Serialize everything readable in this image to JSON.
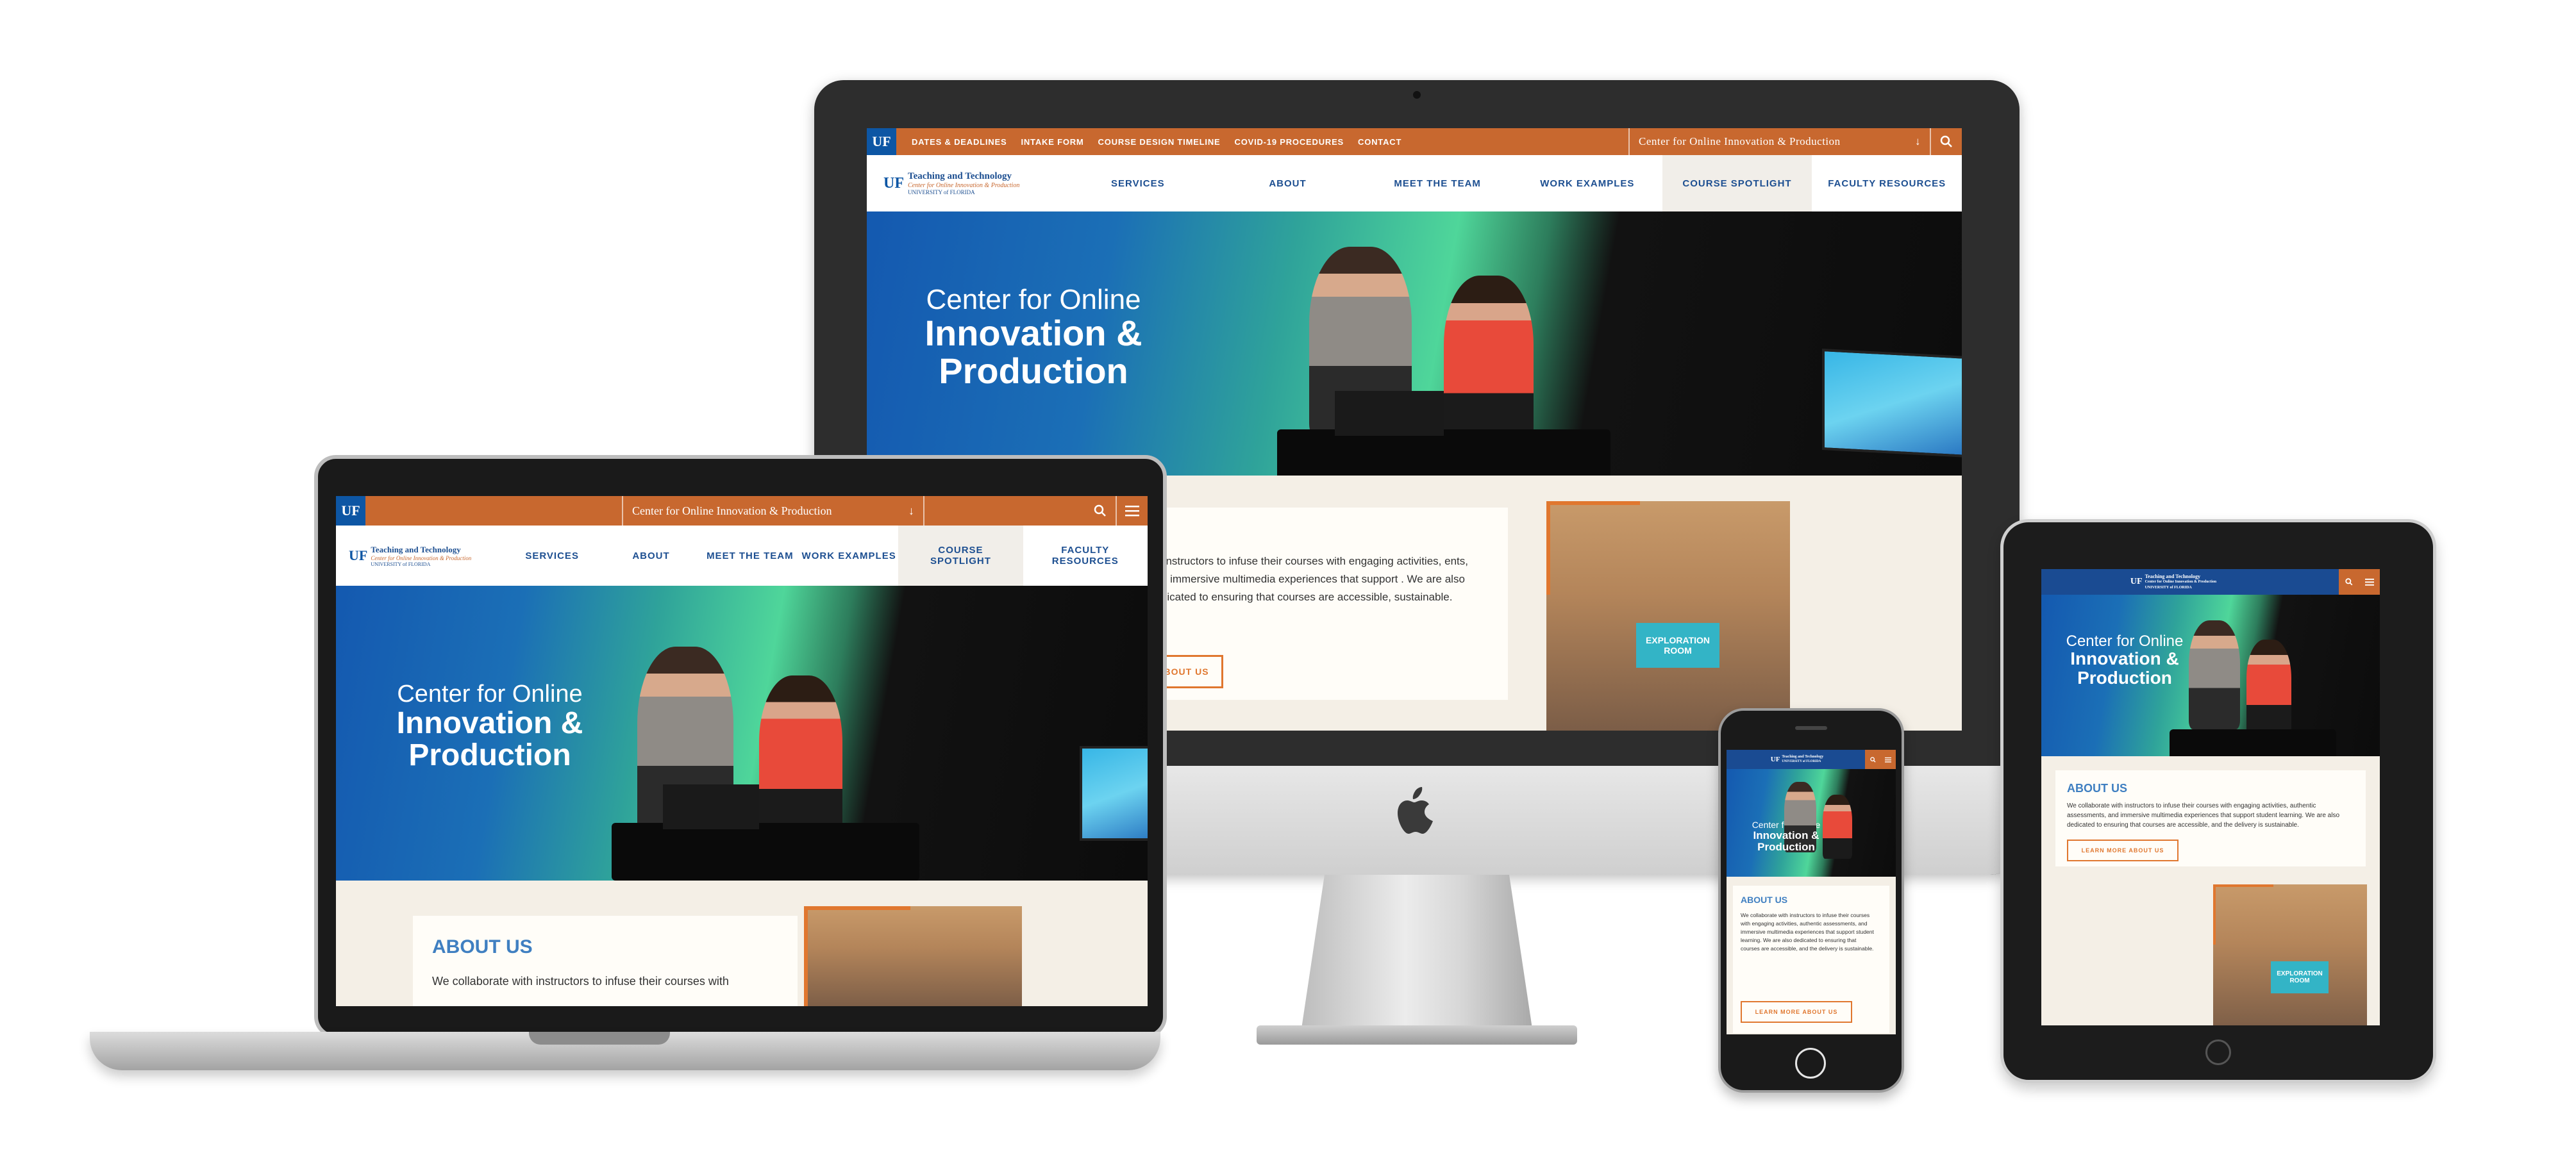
{
  "site": {
    "logo": "UF",
    "brand_title": "Teaching and Technology",
    "brand_subtitle": "Center for Online Innovation & Production",
    "brand_university": "UNIVERSITY of FLORIDA",
    "utility_links": [
      "DATES & DEADLINES",
      "INTAKE FORM",
      "COURSE DESIGN TIMELINE",
      "COVID-19 PROCEDURES",
      "CONTACT"
    ],
    "dropdown_label": "Center for Online Innovation & Production",
    "nav": [
      "SERVICES",
      "ABOUT",
      "MEET THE TEAM",
      "WORK EXAMPLES",
      "COURSE SPOTLIGHT",
      "FACULTY RESOURCES"
    ],
    "nav_laptop": [
      "SERVICES",
      "ABOUT",
      "MEET THE TEAM",
      "WORK EXAMPLES",
      "COURSE SPOTLIGHT",
      "FACULTY RESOURCES"
    ],
    "hero_line1": "Center for Online",
    "hero_line2": "Innovation &",
    "hero_line3": "Production",
    "about_heading": "ABOUT US",
    "about_text_desktop": "ch instructors to infuse their courses with engaging activities, ents, and immersive multimedia experiences that support . We are also dedicated to ensuring that courses are accessible, sustainable.",
    "about_text_laptop": "We collaborate with instructors to infuse their courses with",
    "about_text_tablet": "We collaborate with instructors to infuse their courses with engaging activities, authentic assessments, and immersive multimedia experiences that support student learning. We are also dedicated to ensuring that courses are accessible, and the delivery is sustainable.",
    "about_text_phone": "We collaborate with instructors to infuse their courses with engaging activities, authentic assessments, and immersive multimedia experiences that support student learning. We are also dedicated to ensuring that courses are accessible, and the delivery is sustainable.",
    "about_button_desktop": "ABOUT US",
    "about_button": "LEARN MORE ABOUT US",
    "about_heading_partial": "S",
    "photo_sign": "EXPLORATION ROOM"
  },
  "colors": {
    "orange": "#c8682f",
    "blue": "#0d56a4",
    "nav_blue": "#1d4f91",
    "accent_orange": "#f07a25",
    "about_blue": "#3f7fc1"
  },
  "icons": [
    "search-icon",
    "menu-icon",
    "chevron-down-icon",
    "apple-logo-icon"
  ]
}
